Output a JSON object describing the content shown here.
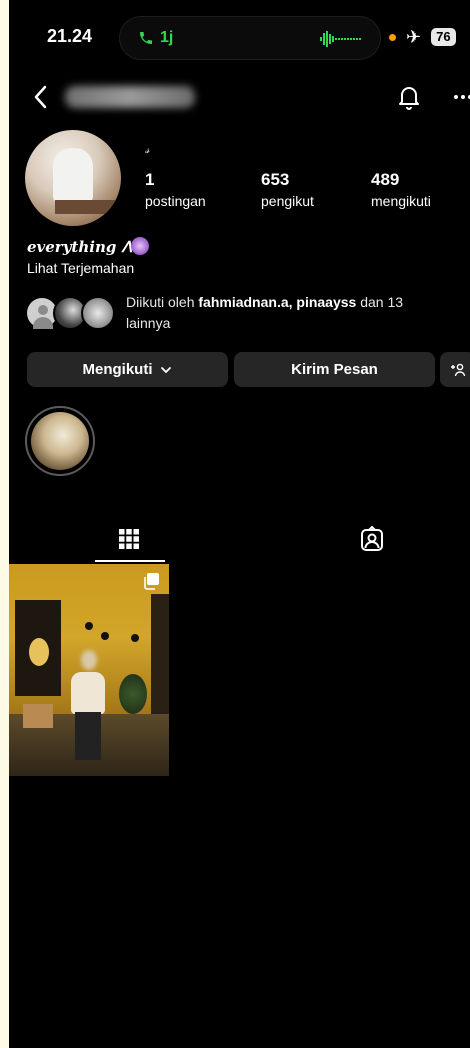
{
  "status_bar": {
    "time": "21.24",
    "call_duration": "1j",
    "battery": "76",
    "call_color": "#32d74b",
    "dot_color": "#ff9f0a",
    "icons": [
      "phone-icon",
      "waveform-icon",
      "airplane-icon"
    ]
  },
  "nav": {
    "icons": [
      "back-chevron-icon",
      "bell-icon",
      "more-icon"
    ]
  },
  "profile": {
    "note": "𝓈",
    "stats": [
      {
        "value": "1",
        "label": "postingan"
      },
      {
        "value": "653",
        "label": "pengikut"
      },
      {
        "value": "489",
        "label": "mengikuti"
      }
    ],
    "bio_name": "everything ⴷ˚",
    "translate_label": "Lihat Terjemahan",
    "followed_by_prefix": "Diikuti oleh",
    "followed_by_users": "fahmiadnan.a, pinaayss",
    "followed_by_conjunction": "dan 13",
    "followed_by_suffix": "lainnya"
  },
  "actions": {
    "following_label": "Mengikuti",
    "message_label": "Kirim Pesan",
    "add_icon": "add-person-icon"
  },
  "tabs": {
    "icons": [
      "grid-icon",
      "tagged-icon"
    ]
  },
  "posts": {
    "count": 1,
    "icons": [
      "multiple-images-icon"
    ]
  }
}
